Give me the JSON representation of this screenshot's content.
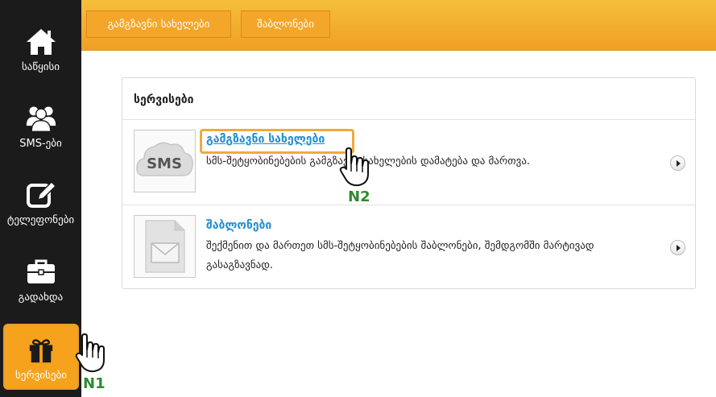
{
  "sidebar": {
    "items": [
      {
        "label": "საწყისი",
        "icon": "home-icon"
      },
      {
        "label": "SMS-ები",
        "icon": "users-icon"
      },
      {
        "label": "ტელეფონები",
        "icon": "edit-icon"
      },
      {
        "label": "გადახდა",
        "icon": "briefcase-icon"
      },
      {
        "label": "სერვისები",
        "icon": "gift-icon",
        "active": true
      }
    ]
  },
  "toolbar": {
    "buttons": [
      {
        "label": "გამგზავნი სახელები"
      },
      {
        "label": "შაბლონები"
      }
    ]
  },
  "services": {
    "title": "სერვისები",
    "rows": [
      {
        "title": "გამგზავნი სახელები",
        "description": "სმს-შეტყობინებების გამგზავნი სახელების დამატება და მართვა.",
        "thumb_text": "SMS",
        "icon": "sms-cloud-icon"
      },
      {
        "title": "შაბლონები",
        "description": "შექმენით და მართეთ სმს-შეტყობინებების შაბლონები, შემდგომში მარტივად გასაგზავნად.",
        "icon": "envelope-icon"
      }
    ]
  },
  "annotations": {
    "n1": "N1",
    "n2": "N2"
  },
  "colors": {
    "accent": "#f6a21d",
    "sidebar_bg": "#1b1b1b",
    "link": "#1f8fd1",
    "marker": "#2e8b2e"
  }
}
